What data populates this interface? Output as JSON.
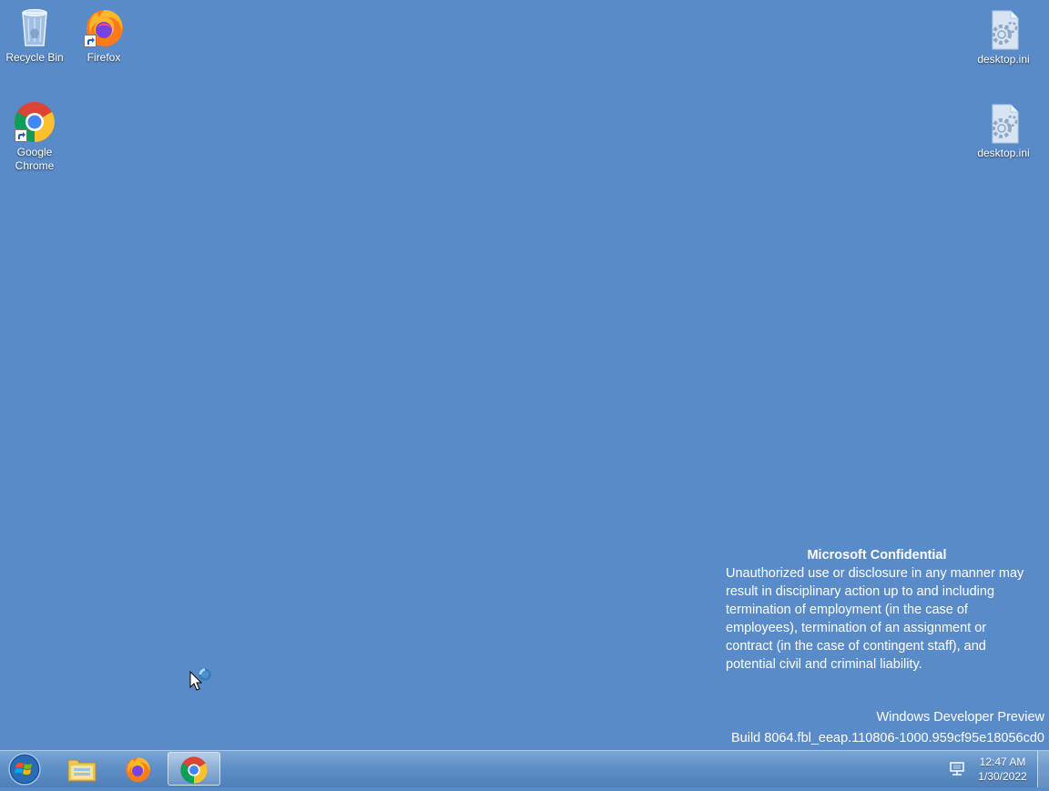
{
  "desktop": {
    "icons": [
      {
        "label": "Recycle Bin",
        "icon": "recycle-bin-icon"
      },
      {
        "label": "Firefox",
        "icon": "firefox-icon"
      },
      {
        "label": "Google Chrome",
        "icon": "chrome-icon"
      },
      {
        "label": "desktop.ini",
        "icon": "settings-file-icon"
      },
      {
        "label": "desktop.ini",
        "icon": "settings-file-icon"
      }
    ],
    "watermark": {
      "title": "Microsoft Confidential",
      "body": "Unauthorized use or disclosure in any manner may result in disciplinary action up to and including termination of employment (in the case of employees), termination of an assignment or contract (in the case of contingent staff), and potential civil and criminal liability.",
      "product": "Windows Developer Preview",
      "build": "Build 8064.fbl_eeap.110806-1000.959cf95e18056cd0"
    }
  },
  "taskbar": {
    "buttons": [
      {
        "icon": "start-orb-icon"
      },
      {
        "icon": "file-explorer-icon"
      },
      {
        "icon": "firefox-icon"
      },
      {
        "icon": "chrome-icon",
        "active": true
      }
    ],
    "tray": {
      "network_icon": "network-icon",
      "time": "12:47 AM",
      "date": "1/30/2022"
    }
  },
  "colors": {
    "desktop_background": "#5a8bc9",
    "taskbar": "#5e8fc6"
  }
}
